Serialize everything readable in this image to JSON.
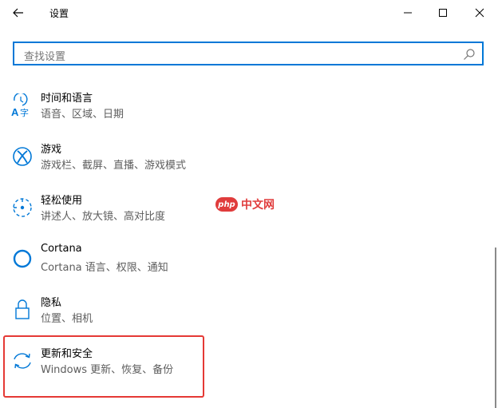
{
  "window": {
    "title": "设置"
  },
  "search": {
    "placeholder": "查找设置"
  },
  "items": [
    {
      "title": "时间和语言",
      "subtitle": "语音、区域、日期",
      "icon": "time-language-icon"
    },
    {
      "title": "游戏",
      "subtitle": "游戏栏、截屏、直播、游戏模式",
      "icon": "xbox-icon"
    },
    {
      "title": "轻松使用",
      "subtitle": "讲述人、放大镜、高对比度",
      "icon": "ease-of-access-icon"
    },
    {
      "title": "Cortana",
      "subtitle": "Cortana 语言、权限、通知",
      "icon": "cortana-icon"
    },
    {
      "title": "隐私",
      "subtitle": "位置、相机",
      "icon": "lock-icon"
    },
    {
      "title": "更新和安全",
      "subtitle": "Windows 更新、恢复、备份",
      "icon": "update-sync-icon"
    }
  ],
  "watermark": {
    "logo": "php",
    "text": "中文网"
  },
  "colors": {
    "accent": "#0078d7",
    "highlight": "#e53935",
    "watermark": "#e03c3c"
  }
}
